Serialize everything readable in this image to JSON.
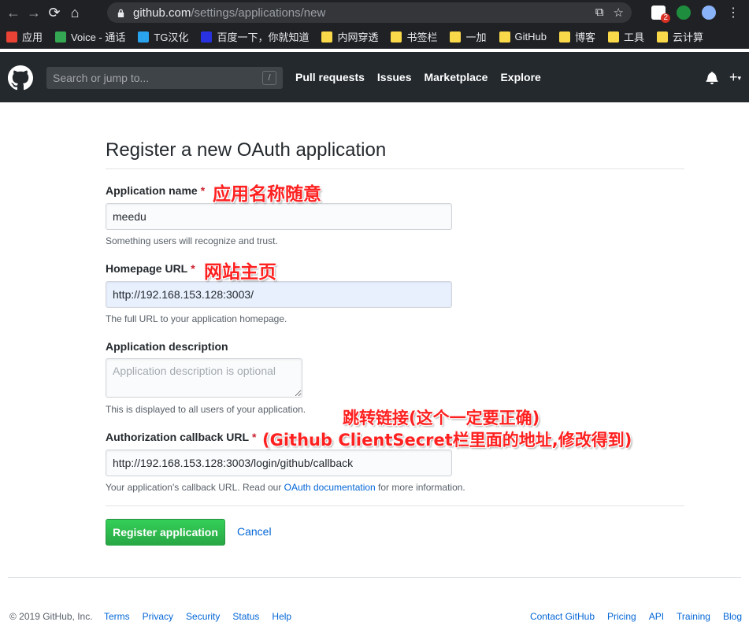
{
  "browser": {
    "url_host": "github.com",
    "url_path": "/settings/applications/new",
    "ext_badge": "2",
    "bookmarks": [
      {
        "label": "应用",
        "color": "#ea4335"
      },
      {
        "label": "Voice - 通话",
        "color": "#34a853"
      },
      {
        "label": "TG汉化",
        "color": "#2aa3ef"
      },
      {
        "label": "百度一下，你就知道",
        "color": "#2932e1"
      },
      {
        "label": "内网穿透",
        "color": "#f9d849"
      },
      {
        "label": "书签栏",
        "color": "#f9d849"
      },
      {
        "label": "一加",
        "color": "#f9d849"
      },
      {
        "label": "GitHub",
        "color": "#f9d849"
      },
      {
        "label": "博客",
        "color": "#f9d849"
      },
      {
        "label": "工具",
        "color": "#f9d849"
      },
      {
        "label": "云计算",
        "color": "#f9d849"
      }
    ]
  },
  "header": {
    "search_placeholder": "Search or jump to...",
    "slash_key": "/",
    "nav": [
      "Pull requests",
      "Issues",
      "Marketplace",
      "Explore"
    ],
    "plus": "+"
  },
  "form": {
    "title": "Register a new OAuth application",
    "required_mark": "*",
    "app_name_label": "Application name",
    "app_name_value": "meedu",
    "app_name_hint": "Something users will recognize and trust.",
    "homepage_label": "Homepage URL",
    "homepage_value": "http://192.168.153.128:3003/",
    "homepage_hint": "The full URL to your application homepage.",
    "description_label": "Application description",
    "description_placeholder": "Application description is optional",
    "description_hint": "This is displayed to all users of your application.",
    "callback_label": "Authorization callback URL",
    "callback_value": "http://192.168.153.128:3003/login/github/callback",
    "callback_hint_prefix": "Your application's callback URL. Read our ",
    "callback_hint_link": "OAuth documentation",
    "callback_hint_suffix": " for more information.",
    "submit_label": "Register application",
    "cancel_label": "Cancel"
  },
  "annotations": {
    "app_name": "应用名称随意",
    "homepage": "网站主页",
    "callback_line1": "跳转链接(这个一定要正确)",
    "callback_line2": "(Github ClientSecret栏里面的地址,修改得到)"
  },
  "footer": {
    "copyright": "© 2019 GitHub, Inc.",
    "left_links": [
      "Terms",
      "Privacy",
      "Security",
      "Status",
      "Help"
    ],
    "right_links": [
      "Contact GitHub",
      "Pricing",
      "API",
      "Training",
      "Blog"
    ]
  },
  "colors": {
    "primary_green": "#28a745",
    "link_blue": "#0366d6",
    "required_red": "#cb2431",
    "annotation_red": "#ff2020",
    "header_bg": "#24292e"
  }
}
